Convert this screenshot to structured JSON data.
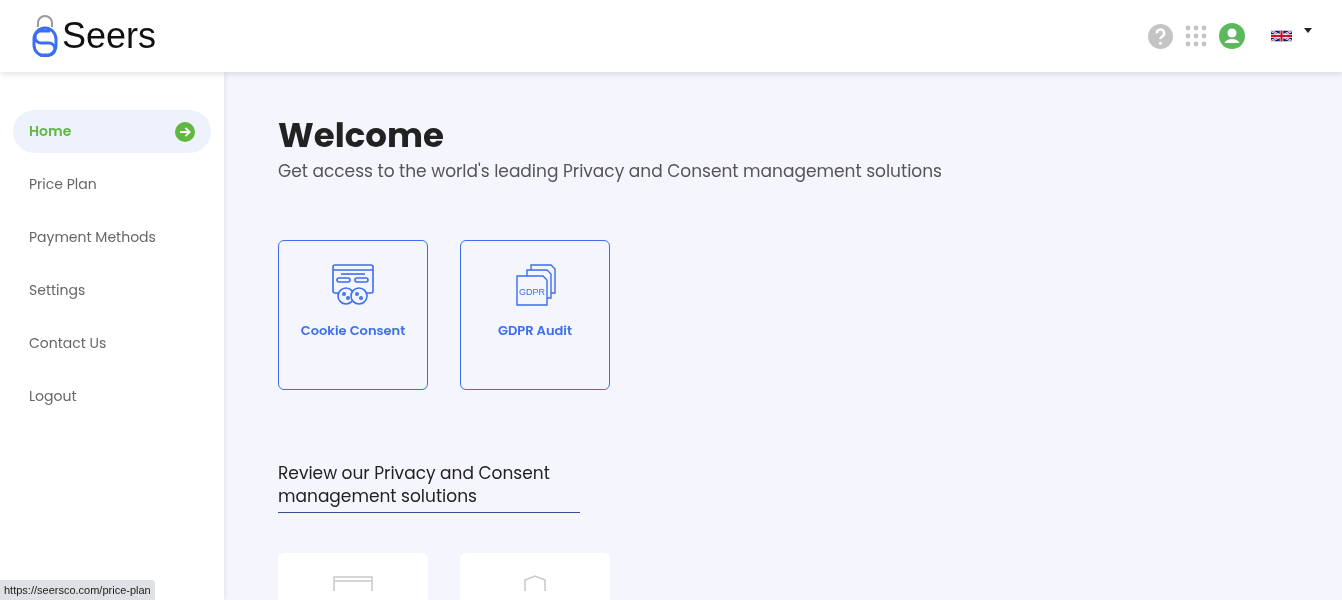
{
  "header": {
    "logo_text": "Seers"
  },
  "sidebar": {
    "items": [
      {
        "label": "Home",
        "selected": true
      },
      {
        "label": "Price Plan",
        "selected": false
      },
      {
        "label": "Payment Methods",
        "selected": false
      },
      {
        "label": "Settings",
        "selected": false
      },
      {
        "label": "Contact Us",
        "selected": false
      },
      {
        "label": "Logout",
        "selected": false
      }
    ]
  },
  "main": {
    "title": "Welcome",
    "subtitle": "Get access to the world's leading Privacy and Consent management solutions",
    "products": [
      {
        "kind": "cookie",
        "label": "Cookie Consent"
      },
      {
        "kind": "gdpr",
        "label": "GDPR Audit",
        "icon_text": "GDPR"
      }
    ],
    "review_heading": "Review our Privacy and Consent management solutions",
    "review_cards": [
      {
        "kind": "browser"
      },
      {
        "kind": "shield"
      }
    ]
  },
  "status_url": "https://seersco.com/price-plan"
}
